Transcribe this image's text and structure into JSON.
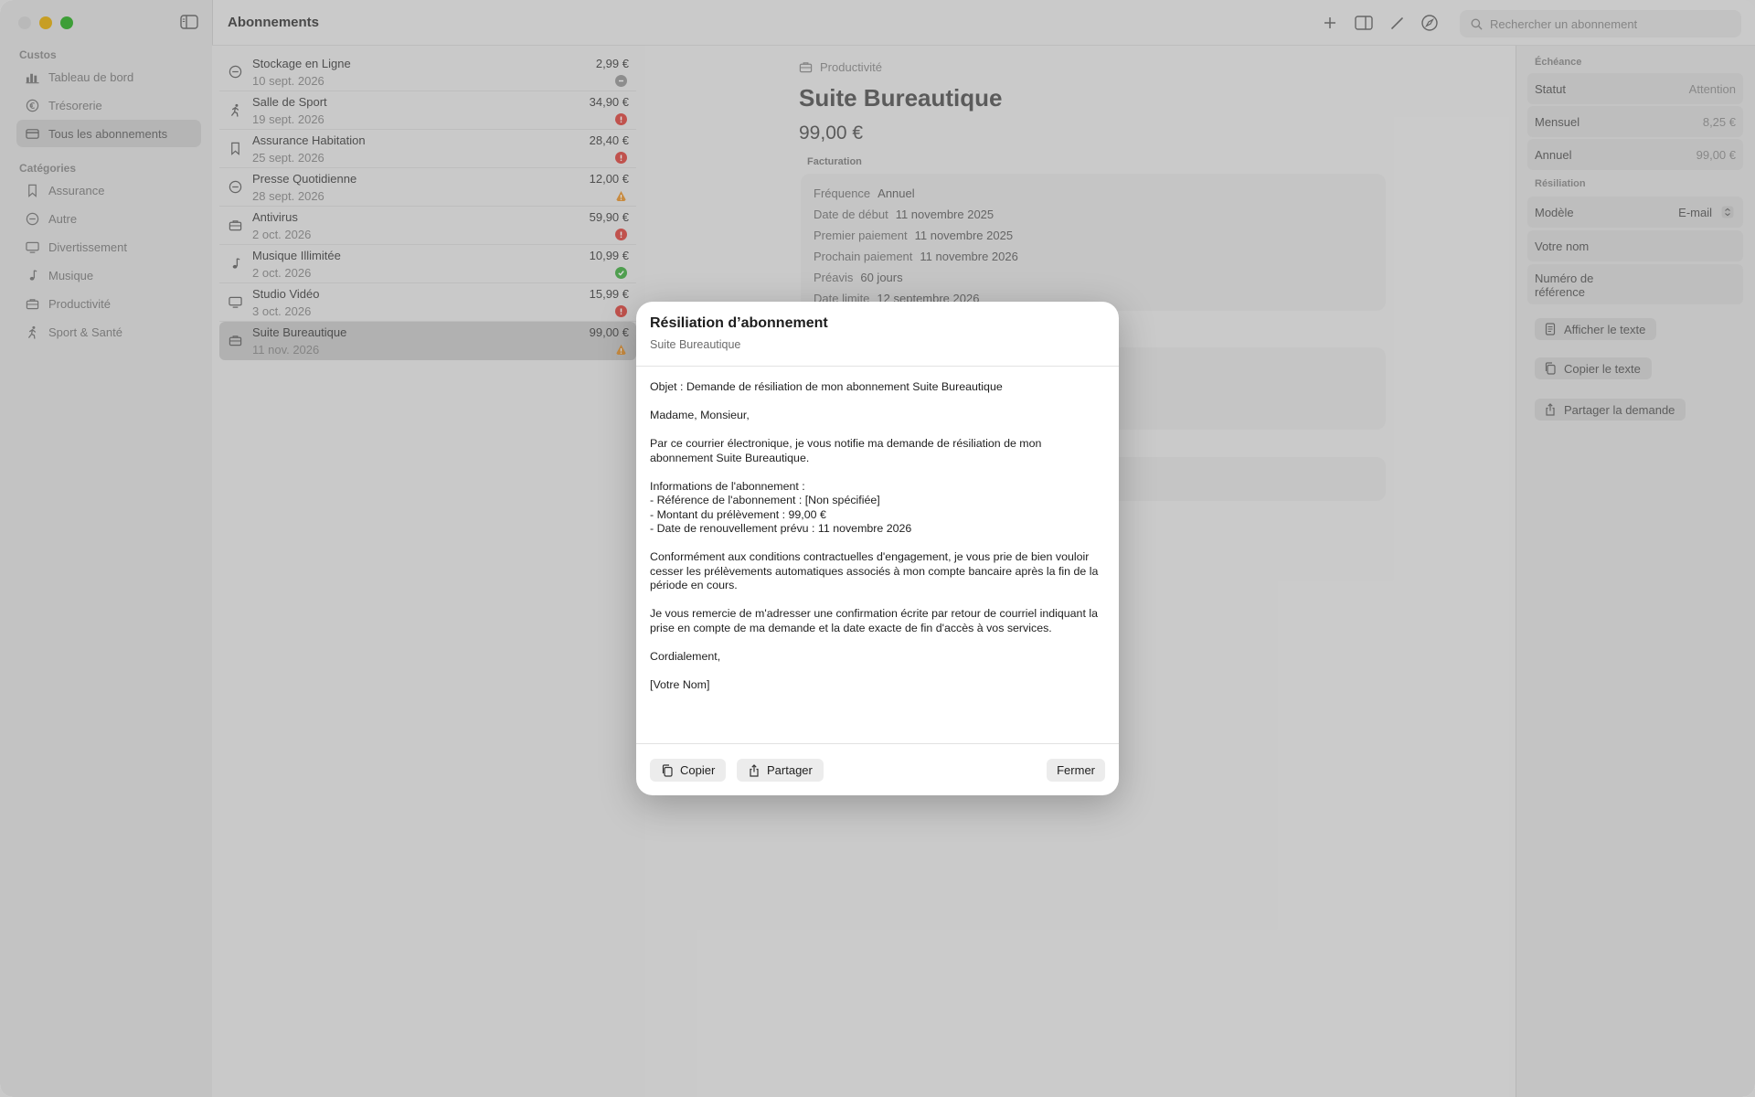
{
  "window": {
    "title": "Abonnements"
  },
  "sidebar": {
    "section_main": "Custos",
    "main_items": [
      {
        "label": "Tableau de bord",
        "icon": "chart-bar-icon"
      },
      {
        "label": "Trésorerie",
        "icon": "euro-circle-icon"
      },
      {
        "label": "Tous les abonnements",
        "icon": "creditcard-icon"
      }
    ],
    "section_categories": "Catégories",
    "category_items": [
      {
        "label": "Assurance",
        "icon": "bookmark-icon"
      },
      {
        "label": "Autre",
        "icon": "minus-circle-icon"
      },
      {
        "label": "Divertissement",
        "icon": "tv-icon"
      },
      {
        "label": "Musique",
        "icon": "music-note-icon"
      },
      {
        "label": "Productivité",
        "icon": "briefcase-icon"
      },
      {
        "label": "Sport & Santé",
        "icon": "runner-icon"
      }
    ]
  },
  "toolbar": {
    "search_placeholder": "Rechercher un abonnement"
  },
  "list": {
    "items": [
      {
        "name": "Stockage en Ligne",
        "date": "10 sept. 2026",
        "price": "2,99 €",
        "status": "neutral",
        "icon": "minus-circle-icon"
      },
      {
        "name": "Salle de Sport",
        "date": "19 sept. 2026",
        "price": "34,90 €",
        "status": "alert",
        "icon": "runner-icon"
      },
      {
        "name": "Assurance Habitation",
        "date": "25 sept. 2026",
        "price": "28,40 €",
        "status": "alert",
        "icon": "bookmark-icon"
      },
      {
        "name": "Presse Quotidienne",
        "date": "28 sept. 2026",
        "price": "12,00 €",
        "status": "warning",
        "icon": "minus-circle-icon"
      },
      {
        "name": "Antivirus",
        "date": "2 oct. 2026",
        "price": "59,90 €",
        "status": "alert",
        "icon": "briefcase-icon"
      },
      {
        "name": "Musique Illimitée",
        "date": "2 oct. 2026",
        "price": "10,99 €",
        "status": "ok",
        "icon": "music-note-icon"
      },
      {
        "name": "Studio Vidéo",
        "date": "3 oct. 2026",
        "price": "15,99 €",
        "status": "alert",
        "icon": "tv-icon"
      },
      {
        "name": "Suite Bureautique",
        "date": "11 nov. 2026",
        "price": "99,00 €",
        "status": "warning",
        "icon": "briefcase-icon"
      }
    ]
  },
  "colors": {
    "alert": "#e0605a",
    "warning": "#e9a24b",
    "ok": "#5cb85c",
    "neutral": "#a5a5a5"
  },
  "detail": {
    "category": "Productivité",
    "title": "Suite Bureautique",
    "price": "99,00 €",
    "section_billing": "Facturation",
    "billing": [
      {
        "label": "Fréquence",
        "value": "Annuel"
      },
      {
        "label": "Date de début",
        "value": "11 novembre 2025"
      },
      {
        "label": "Premier paiement",
        "value": "11 novembre 2025"
      },
      {
        "label": "Prochain paiement",
        "value": "11 novembre 2026"
      },
      {
        "label": "Préavis",
        "value": "60 jours"
      },
      {
        "label": "Date limite",
        "value": "12 septembre 2026"
      }
    ]
  },
  "inspector": {
    "section_due": "Échéance",
    "due_rows": [
      {
        "label": "Statut",
        "value": "Attention"
      },
      {
        "label": "Mensuel",
        "value": "8,25 €"
      },
      {
        "label": "Annuel",
        "value": "99,00 €"
      }
    ],
    "section_cancel": "Résiliation",
    "model_label": "Modèle",
    "model_value": "E-mail",
    "name_label": "Votre nom",
    "reference_label_line1": "Numéro de",
    "reference_label_line2": "référence",
    "show_text": "Afficher le texte",
    "copy_text": "Copier le texte",
    "share_request": "Partager la demande"
  },
  "modal": {
    "title": "Résiliation d’abonnement",
    "subtitle": "Suite Bureautique",
    "lines": {
      "object": "Objet : Demande de résiliation de mon abonnement Suite Bureautique",
      "greeting": "Madame, Monsieur,",
      "p1": "Par ce courrier électronique, je vous notifie ma demande de résiliation de mon abonnement Suite Bureautique.",
      "info_title": "Informations de l'abonnement :",
      "info_ref": "- Référence de l'abonnement : [Non spécifiée]",
      "info_amount": "- Montant du prélèvement : 99,00 €",
      "info_date": "- Date de renouvellement prévu : 11 novembre 2026",
      "p2": "Conformément aux conditions contractuelles d'engagement, je vous prie de bien vouloir cesser les prélèvements automatiques associés à mon compte bancaire après la fin de la période en cours.",
      "p3": "Je vous remercie de m'adresser une confirmation écrite par retour de courriel indiquant la prise en compte de ma demande et la date exacte de fin d'accès à vos services.",
      "closing": "Cordialement,",
      "signature": "[Votre Nom]"
    },
    "copy_label": "Copier",
    "share_label": "Partager",
    "close_label": "Fermer"
  }
}
